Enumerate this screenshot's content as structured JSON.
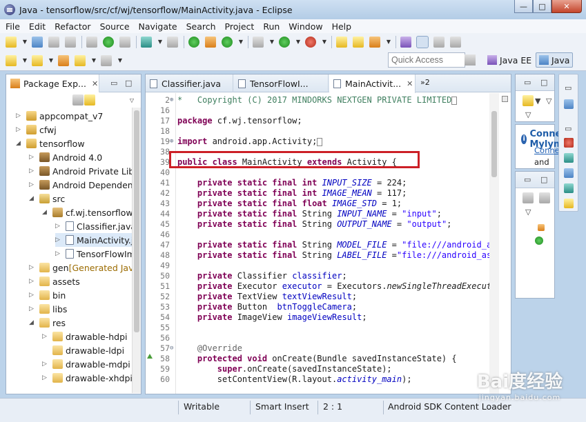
{
  "window": {
    "title": "Java - tensorflow/src/cf/wj/tensorflow/MainActivity.java - Eclipse",
    "controls": [
      "—",
      "□",
      "✕"
    ]
  },
  "menu": [
    "File",
    "Edit",
    "Refactor",
    "Source",
    "Navigate",
    "Search",
    "Project",
    "Run",
    "Window",
    "Help"
  ],
  "toolbar": {
    "quick_access": "Quick Access",
    "perspectives": [
      "Java EE",
      "Java"
    ]
  },
  "package_explorer": {
    "tab_label": "Package Exp...",
    "tree": [
      {
        "label": "appcompat_v7",
        "twisty": "▷",
        "icon": "project",
        "depth": 0
      },
      {
        "label": "cfwj",
        "twisty": "▷",
        "icon": "project",
        "depth": 0
      },
      {
        "label": "tensorflow",
        "twisty": "◢",
        "icon": "project",
        "depth": 0
      },
      {
        "label": "Android 4.0",
        "twisty": "▷",
        "icon": "library",
        "depth": 1
      },
      {
        "label": "Android Private Libraries",
        "twisty": "▷",
        "icon": "library",
        "depth": 1
      },
      {
        "label": "Android Dependencies",
        "twisty": "▷",
        "icon": "library",
        "depth": 1
      },
      {
        "label": "src",
        "twisty": "◢",
        "icon": "source-folder",
        "depth": 1
      },
      {
        "label": "cf.wj.tensorflow",
        "twisty": "◢",
        "icon": "package",
        "depth": 2
      },
      {
        "label": "Classifier.java",
        "twisty": "▷",
        "icon": "java-file",
        "depth": 3
      },
      {
        "label": "MainActivity.java",
        "twisty": "▷",
        "icon": "java-file",
        "depth": 3,
        "selected": true
      },
      {
        "label": "TensorFlowImageClassifier.java",
        "twisty": "▷",
        "icon": "java-file",
        "depth": 3
      },
      {
        "label": "gen",
        "suffix": " [Generated Java Files]",
        "twisty": "▷",
        "icon": "folder",
        "depth": 1
      },
      {
        "label": "assets",
        "twisty": "▷",
        "icon": "folder",
        "depth": 1
      },
      {
        "label": "bin",
        "twisty": "▷",
        "icon": "folder",
        "depth": 1
      },
      {
        "label": "libs",
        "twisty": "▷",
        "icon": "folder",
        "depth": 1
      },
      {
        "label": "res",
        "twisty": "◢",
        "icon": "folder",
        "depth": 1
      },
      {
        "label": "drawable-hdpi",
        "twisty": "▷",
        "icon": "folder",
        "depth": 2
      },
      {
        "label": "drawable-ldpi",
        "twisty": "",
        "icon": "folder",
        "depth": 2
      },
      {
        "label": "drawable-mdpi",
        "twisty": "▷",
        "icon": "folder",
        "depth": 2
      },
      {
        "label": "drawable-xhdpi",
        "twisty": "▷",
        "icon": "folder",
        "depth": 2
      }
    ]
  },
  "editor": {
    "tabs": [
      {
        "label": "Classifier.java"
      },
      {
        "label": "TensorFlowI..."
      },
      {
        "label": "MainActivit...",
        "active": true
      }
    ],
    "more_tabs": "»2",
    "lines": [
      {
        "n": "2",
        "fold": "⊕",
        "segs": [
          [
            "cm",
            "*   Copyright (C) 2017 MINDORKS NEXTGEN PRIVATE LIMITED"
          ]
        ],
        "box": true
      },
      {
        "n": "16",
        "segs": []
      },
      {
        "n": "17",
        "segs": [
          [
            "kw",
            "package"
          ],
          [
            "",
            " cf.wj.tensorflow;"
          ]
        ]
      },
      {
        "n": "18",
        "segs": []
      },
      {
        "n": "19",
        "fold": "⊕",
        "segs": [
          [
            "kw",
            "import"
          ],
          [
            "",
            " android.app.Activity;"
          ]
        ],
        "box": true
      },
      {
        "n": "38",
        "segs": []
      },
      {
        "n": "39",
        "segs": [
          [
            "kw",
            "public class"
          ],
          [
            "",
            " MainActivity "
          ],
          [
            "kw",
            "extends"
          ],
          [
            "",
            " Activity {"
          ]
        ]
      },
      {
        "n": "40",
        "segs": []
      },
      {
        "n": "41",
        "segs": [
          [
            "",
            "    "
          ],
          [
            "kw",
            "private static final int"
          ],
          [
            "",
            " "
          ],
          [
            "fd",
            "INPUT_SIZE"
          ],
          [
            "",
            " = 224;"
          ]
        ]
      },
      {
        "n": "42",
        "segs": [
          [
            "",
            "    "
          ],
          [
            "kw",
            "private static final int"
          ],
          [
            "",
            " "
          ],
          [
            "fd",
            "IMAGE_MEAN"
          ],
          [
            "",
            " = 117;"
          ]
        ]
      },
      {
        "n": "43",
        "segs": [
          [
            "",
            "    "
          ],
          [
            "kw",
            "private static final float"
          ],
          [
            "",
            " "
          ],
          [
            "fd",
            "IMAGE_STD"
          ],
          [
            "",
            " = 1;"
          ]
        ]
      },
      {
        "n": "44",
        "segs": [
          [
            "",
            "    "
          ],
          [
            "kw",
            "private static final"
          ],
          [
            "",
            " String "
          ],
          [
            "fd",
            "INPUT_NAME"
          ],
          [
            "",
            " = "
          ],
          [
            "st",
            "\"input\""
          ],
          [
            "",
            ";"
          ]
        ]
      },
      {
        "n": "45",
        "segs": [
          [
            "",
            "    "
          ],
          [
            "kw",
            "private static final"
          ],
          [
            "",
            " String "
          ],
          [
            "fd",
            "OUTPUT_NAME"
          ],
          [
            "",
            " = "
          ],
          [
            "st",
            "\"output\""
          ],
          [
            "",
            ";"
          ]
        ]
      },
      {
        "n": "46",
        "segs": []
      },
      {
        "n": "47",
        "segs": [
          [
            "",
            "    "
          ],
          [
            "kw",
            "private static final"
          ],
          [
            "",
            " String "
          ],
          [
            "fd",
            "MODEL_FILE"
          ],
          [
            "",
            " = "
          ],
          [
            "st",
            "\"file:///android_asset/tensorflow_inception_graph.pb\""
          ],
          [
            "",
            ";"
          ]
        ]
      },
      {
        "n": "48",
        "segs": [
          [
            "",
            "    "
          ],
          [
            "kw",
            "private static final"
          ],
          [
            "",
            " String "
          ],
          [
            "fd",
            "LABEL_FILE"
          ],
          [
            "",
            " ="
          ],
          [
            "st",
            "\"file:///android_asset/imagenet_comp_graph_label_strings.txt\""
          ],
          [
            "",
            ";"
          ]
        ]
      },
      {
        "n": "49",
        "segs": []
      },
      {
        "n": "50",
        "segs": [
          [
            "",
            "    "
          ],
          [
            "kw",
            "private"
          ],
          [
            "",
            " Classifier "
          ],
          [
            "fd2",
            "classifier"
          ],
          [
            "",
            ";"
          ]
        ]
      },
      {
        "n": "51",
        "segs": [
          [
            "",
            "    "
          ],
          [
            "kw",
            "private"
          ],
          [
            "",
            " Executor "
          ],
          [
            "fd2",
            "executor"
          ],
          [
            "",
            " = Executors."
          ],
          [
            "ms",
            "newSingleThreadExecutor"
          ],
          [
            "",
            "();"
          ]
        ]
      },
      {
        "n": "52",
        "segs": [
          [
            "",
            "    "
          ],
          [
            "kw",
            "private"
          ],
          [
            "",
            " TextView "
          ],
          [
            "fd2",
            "textViewResult"
          ],
          [
            "",
            ";"
          ]
        ]
      },
      {
        "n": "53",
        "segs": [
          [
            "",
            "    "
          ],
          [
            "kw",
            "private"
          ],
          [
            "",
            " Button  "
          ],
          [
            "fd2",
            "btnToggleCamera"
          ],
          [
            "",
            ";"
          ]
        ]
      },
      {
        "n": "54",
        "segs": [
          [
            "",
            "    "
          ],
          [
            "kw",
            "private"
          ],
          [
            "",
            " ImageView "
          ],
          [
            "fd2",
            "imageViewResult"
          ],
          [
            "",
            ";"
          ]
        ]
      },
      {
        "n": "55",
        "segs": []
      },
      {
        "n": "56",
        "segs": []
      },
      {
        "n": "57",
        "fold": "⊖",
        "segs": [
          [
            "",
            "    "
          ],
          [
            "an",
            "@Override"
          ]
        ]
      },
      {
        "n": "58",
        "segs": [
          [
            "",
            "    "
          ],
          [
            "kw",
            "protected void"
          ],
          [
            "",
            " onCreate(Bundle savedInstanceState) {"
          ]
        ]
      },
      {
        "n": "59",
        "segs": [
          [
            "",
            "        "
          ],
          [
            "kw",
            "super"
          ],
          [
            "",
            ".onCreate(savedInstanceState);"
          ]
        ]
      },
      {
        "n": "60",
        "segs": [
          [
            "",
            "        setContentView(R.layout."
          ],
          [
            "fd",
            "activity_main"
          ],
          [
            "",
            ");"
          ]
        ]
      }
    ]
  },
  "right": {
    "connect_title": "Connect Mylyn",
    "connect_link": "Connect",
    "connect_text": "and"
  },
  "status": {
    "writable": "Writable",
    "insert_mode": "Smart Insert",
    "position": "2 : 1",
    "job": "Android SDK Content Loader"
  },
  "watermark": {
    "logo": "Bai度经验",
    "url": "jingyan.baidu.com"
  }
}
